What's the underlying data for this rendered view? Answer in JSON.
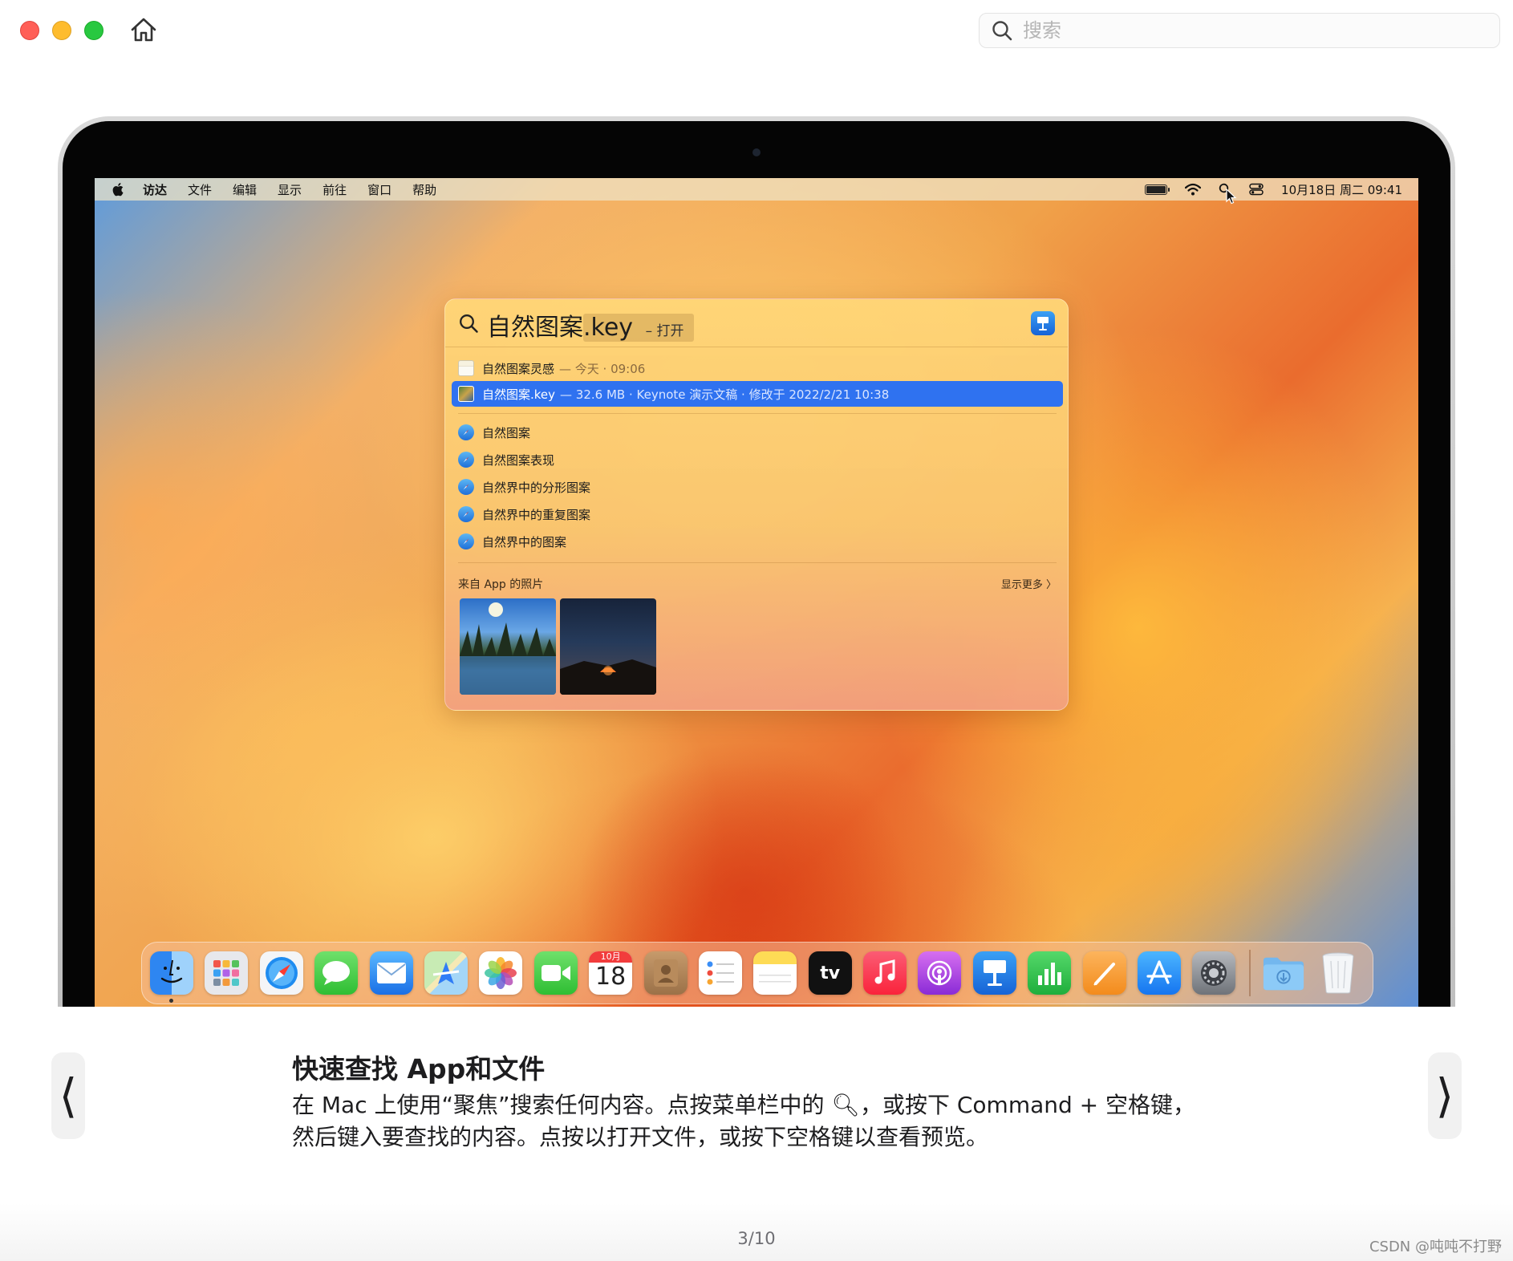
{
  "window": {
    "search_placeholder": "搜索"
  },
  "menubar": {
    "items": [
      "访达",
      "文件",
      "编辑",
      "显示",
      "前往",
      "窗口",
      "帮助"
    ],
    "clock": "10月18日 周二  09:41"
  },
  "spotlight": {
    "query_main": "自然图案",
    "query_completion": ".key",
    "query_hint": "– 打开",
    "results": [
      {
        "title": "自然图案灵感",
        "meta": "— 今天 · 09:06"
      },
      {
        "title": "自然图案.key",
        "meta": "— 32.6 MB · Keynote 演示文稿 · 修改于 2022/2/21 10:38"
      }
    ],
    "suggestions": [
      "自然图案",
      "自然图案表现",
      "自然界中的分形图案",
      "自然界中的重复图案",
      "自然界中的图案"
    ],
    "photos_section": "来自 App 的照片",
    "show_more": "显示更多 〉"
  },
  "dock": {
    "calendar_month": "10月",
    "calendar_day": "18",
    "tv_label": "tv"
  },
  "caption": {
    "title": "快速查找 App和文件",
    "body": "在 Mac 上使用“聚焦”搜索任何内容。点按菜单栏中的 🔍︎，或按下 Command + 空格键，然后键入要查找的内容。点按以打开文件，或按下空格键以查看预览。",
    "prev_label": "⟨",
    "next_label": "⟩"
  },
  "pagination": "3/10",
  "watermark": "CSDN @吨吨不打野"
}
